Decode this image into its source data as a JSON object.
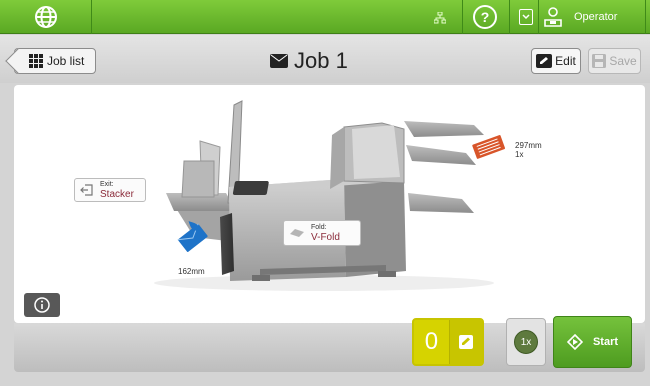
{
  "topbar": {
    "operator_label": "Operator"
  },
  "header": {
    "back_label": "Job list",
    "title": "Job 1",
    "edit_label": "Edit",
    "save_label": "Save"
  },
  "machine": {
    "exit": {
      "label": "Exit:",
      "value": "Stacker"
    },
    "fold": {
      "label": "Fold:",
      "value": "V-Fold"
    },
    "feeder_top": {
      "size": "297mm",
      "count": "1x"
    },
    "feeder_envelope": {
      "size": "162mm"
    }
  },
  "controls": {
    "counter_value": "0",
    "multiplier": "1x",
    "start_label": "Start"
  },
  "colors": {
    "accent_green": "#64b42c",
    "counter_yellow": "#d6d300",
    "value_maroon": "#8b2b3a",
    "document_orange": "#d8552a",
    "envelope_blue": "#1e73c8"
  }
}
